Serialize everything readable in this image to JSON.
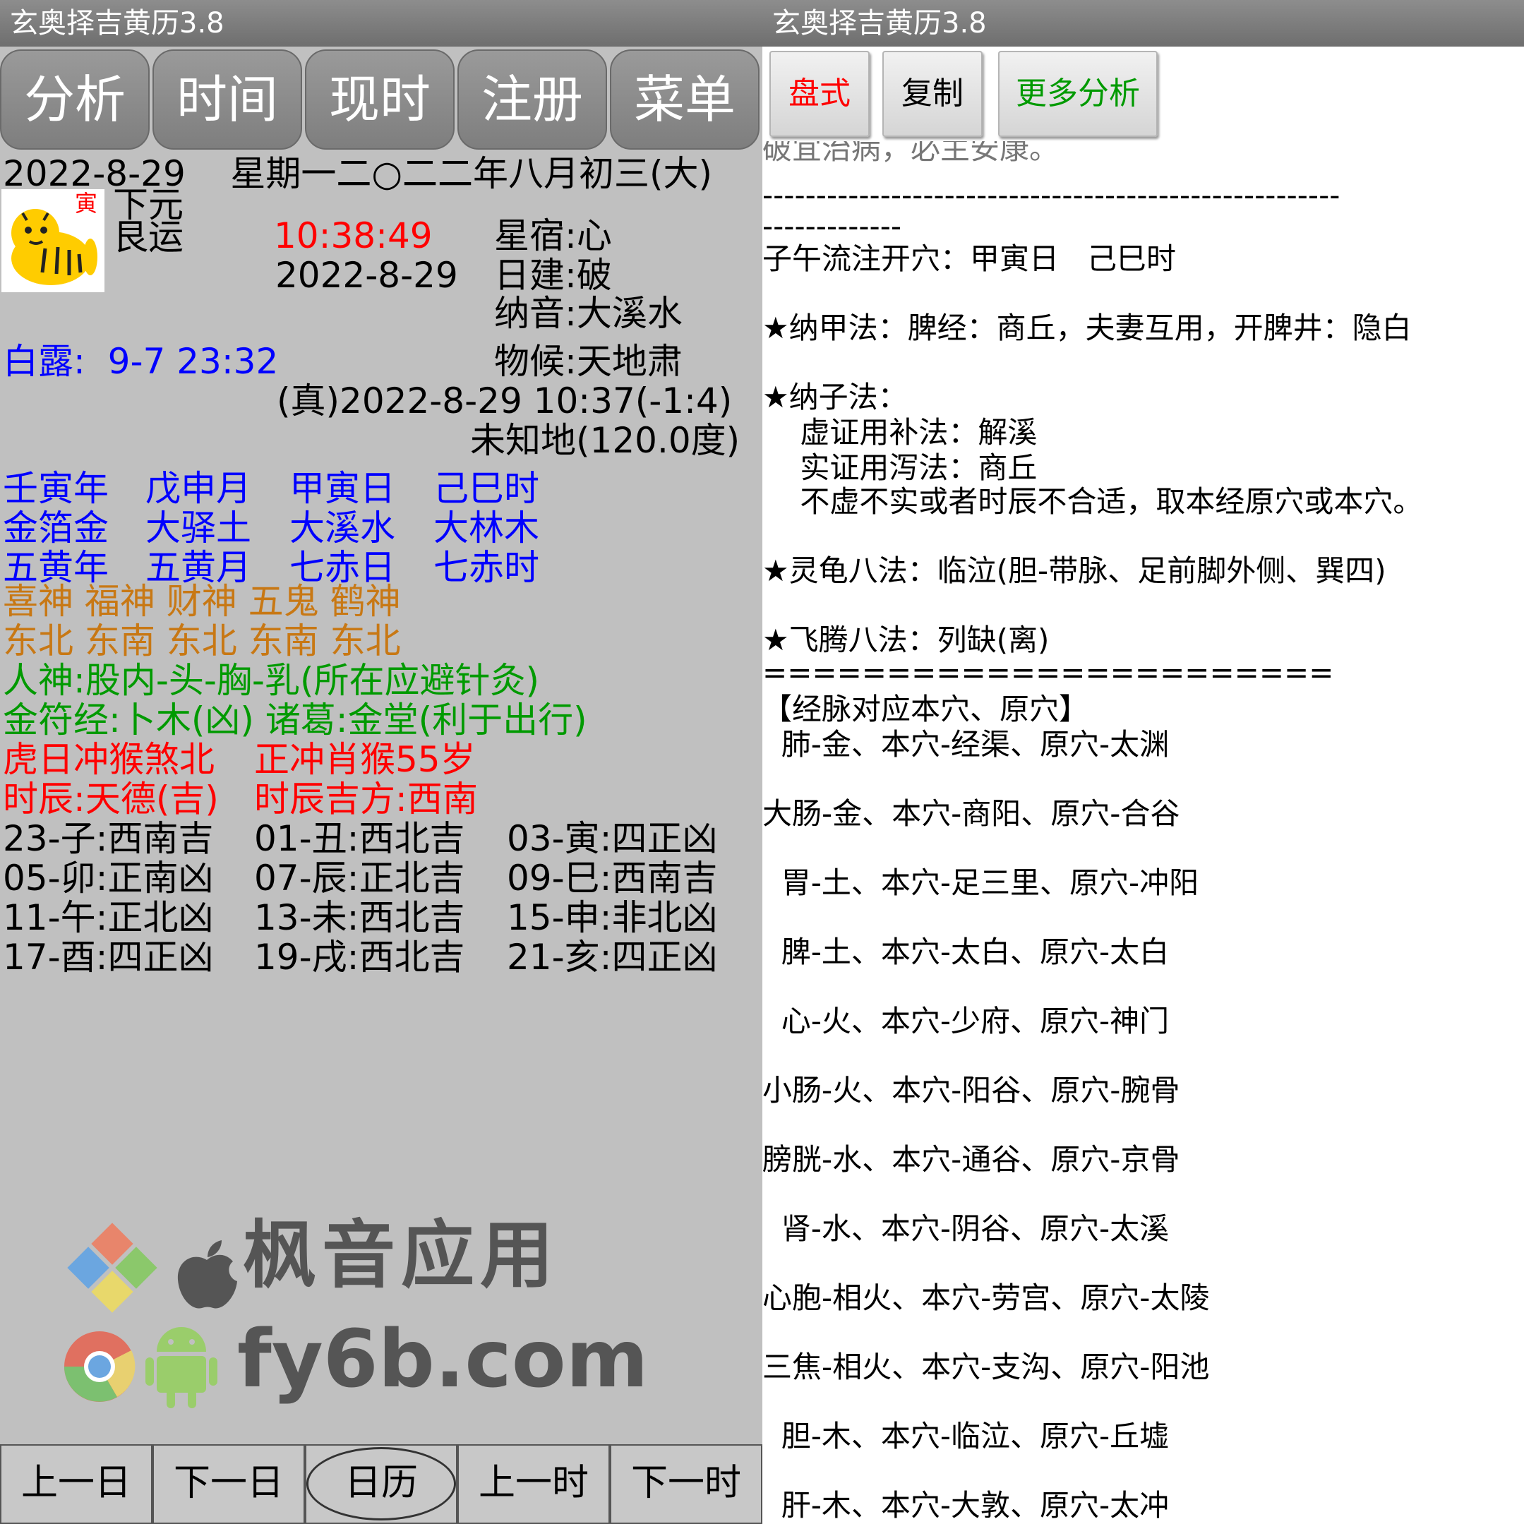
{
  "app_title": "玄奥择吉黄历3.8",
  "left": {
    "tabs": [
      "分析",
      "时间",
      "现时",
      "注册",
      "菜单"
    ],
    "date_line": "2022-8-29    星期一二○二二年八月初三(大)",
    "tiger_badge": "寅",
    "yuan1": "下元",
    "yuan2": "艮运",
    "time": "10:38:49",
    "date2": "2022-8-29",
    "xingxiu": "星宿:心",
    "rijian": "日建:破",
    "nayin": "纳音:大溪水",
    "jieqi": "白露:  9-7 23:32",
    "wuhou": "物候:天地肃",
    "true_time": "(真)2022-8-29 10:37(-1:4)",
    "location": "未知地(120.0度)",
    "ganzhi": [
      "壬寅年",
      "戊申月",
      "甲寅日",
      "己巳时"
    ],
    "nayin_row": [
      "金箔金",
      "大驿土",
      "大溪水",
      "大林木"
    ],
    "star_row": [
      "五黄年",
      "五黄月",
      "七赤日",
      "七赤时"
    ],
    "gods": "喜神 福神 财神 五鬼 鹤神",
    "gods_dir": "东北 东南 东北 东南 东北",
    "renshen": "人神:股内-头-胸-乳(所在应避针灸)",
    "jinfu": "金符经:卜木(凶) 诸葛:金堂(利于出行)",
    "chong1": "虎日冲猴煞北",
    "chong2": "正冲肖猴55岁",
    "shichen1": "时辰:天德(吉)",
    "shichen2": "时辰吉方:西南",
    "hours": [
      [
        "23-子:西南吉",
        "01-丑:西北吉",
        "03-寅:四正凶"
      ],
      [
        "05-卯:正南凶",
        "07-辰:正北吉",
        "09-巳:西南吉"
      ],
      [
        "11-午:正北凶",
        "13-未:西北吉",
        "15-申:非北凶"
      ],
      [
        "17-酉:四正凶",
        "19-戌:西北吉",
        "21-亥:四正凶"
      ]
    ],
    "watermark_cn": "枫音应用",
    "watermark_url": "fy6b.com",
    "bottom": [
      "上一日",
      "下一日",
      "日历",
      "上一时",
      "下一时"
    ]
  },
  "right": {
    "buttons": [
      "盘式",
      "复制",
      "更多分析"
    ],
    "cut_line": "破宜治病，必主安康。",
    "dash1": "------------------------------------------------------",
    "dash2": "-------------",
    "ziwu": "子午流注开穴：甲寅日   己巳时",
    "najia": "★纳甲法：脾经：商丘，夫妻互用，开脾井：隐白",
    "nazi": "★纳子法：",
    "nazi1": "    虚证用补法：解溪",
    "nazi2": "    实证用泻法：商丘",
    "nazi3": "    不虚不实或者时辰不合适，取本经原穴或本穴。",
    "linggui": "★灵龟八法：临泣(胆-带脉、足前脚外侧、巽四)",
    "feiteng": "★飞腾八法：列缺(离)",
    "equals": "=======================",
    "meridian_title": "【经脉对应本穴、原穴】",
    "meridians": [
      "  肺-金、本穴-经渠、原穴-太渊",
      "大肠-金、本穴-商阳、原穴-合谷",
      "  胃-土、本穴-足三里、原穴-冲阳",
      "  脾-土、本穴-太白、原穴-太白",
      "  心-火、本穴-少府、原穴-神门",
      "小肠-火、本穴-阳谷、原穴-腕骨",
      "膀胱-水、本穴-通谷、原穴-京骨",
      "  肾-水、本穴-阴谷、原穴-太溪",
      "心胞-相火、本穴-劳宫、原穴-太陵",
      "三焦-相火、本穴-支沟、原穴-阳池",
      "  胆-木、本穴-临泣、原穴-丘墟",
      "  肝-木、本穴-大敦、原穴-太冲"
    ]
  },
  "colors": {
    "panel_bg": "#c0c0c0",
    "red": "#ff0000",
    "blue": "#0000ff",
    "orange": "#c87814",
    "green": "#009a00",
    "title_bar": "#7a7a7a"
  }
}
